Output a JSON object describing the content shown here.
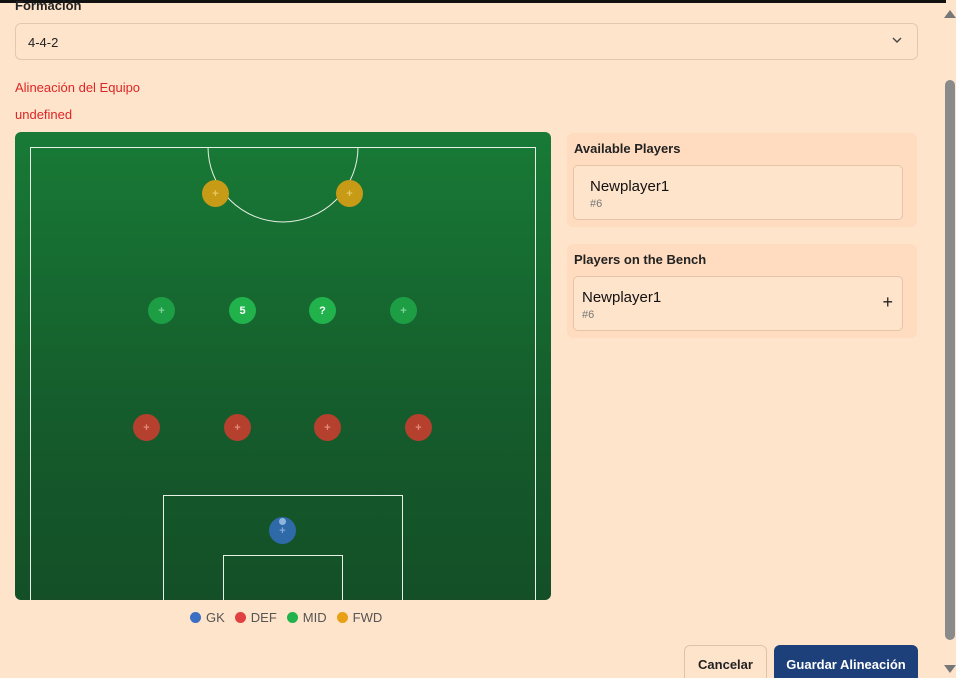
{
  "form": {
    "formation_label": "Formación",
    "formation_value": "4-4-2",
    "lineup_label": "Alineación del Equipo",
    "error_text": "undefined"
  },
  "pitch": {
    "forwards": [
      "+",
      "+"
    ],
    "midfielders": [
      "+",
      "5",
      "?",
      "+"
    ],
    "defenders": [
      "+",
      "+",
      "+",
      "+"
    ],
    "goalkeeper": "+"
  },
  "legend": [
    {
      "label": "GK",
      "color": "#3b6fc4"
    },
    {
      "label": "DEF",
      "color": "#e04040"
    },
    {
      "label": "MID",
      "color": "#22b24c"
    },
    {
      "label": "FWD",
      "color": "#e8a014"
    }
  ],
  "available": {
    "title": "Available Players",
    "players": [
      {
        "name": "Newplayer1",
        "number": "#6"
      }
    ]
  },
  "bench": {
    "title": "Players on the Bench",
    "players": [
      {
        "name": "Newplayer1",
        "number": "#6"
      }
    ]
  },
  "actions": {
    "cancel": "Cancelar",
    "save": "Guardar Alineación"
  }
}
